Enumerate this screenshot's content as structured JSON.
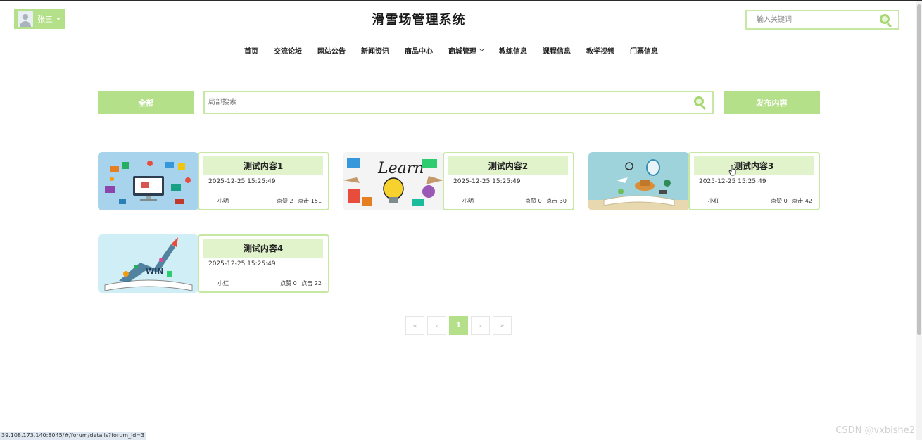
{
  "user": {
    "name": "张三"
  },
  "site": {
    "title": "滑雪场管理系统"
  },
  "top_search": {
    "placeholder": "输入关键词"
  },
  "nav": {
    "items": [
      "首页",
      "交流论坛",
      "网站公告",
      "新闻资讯",
      "商品中心",
      "商城管理",
      "教练信息",
      "课程信息",
      "教学视频",
      "门票信息"
    ]
  },
  "toolbar": {
    "all_label": "全部",
    "local_search_placeholder": "局部搜索",
    "publish_label": "发布内容"
  },
  "posts": [
    {
      "title": "测试内容1",
      "time": "2025-12-25 15:25:49",
      "author": "小明",
      "likes": "点赞 2",
      "clicks": "点击 151",
      "image": "tech-illustration"
    },
    {
      "title": "测试内容2",
      "time": "2025-12-25 15:25:49",
      "author": "小明",
      "likes": "点赞 0",
      "clicks": "点击 30",
      "image": "learn-lightbulb"
    },
    {
      "title": "测试内容3",
      "time": "2025-12-25 15:25:49",
      "author": "小红",
      "likes": "点赞 0",
      "clicks": "点击 42",
      "image": "open-book-travel"
    },
    {
      "title": "测试内容4",
      "time": "2025-12-25 15:25:49",
      "author": "小红",
      "likes": "点赞 0",
      "clicks": "点击 22",
      "image": "book-rocket-win"
    }
  ],
  "pagination": {
    "first": "«",
    "prev": "‹",
    "current": "1",
    "next": "›",
    "last": "»"
  },
  "status_url": "39.108.173.140:8045/#/forum/details?forum_id=3",
  "watermark": "CSDN @vxbishe2",
  "colors": {
    "accent": "#b5e08a",
    "accent_light": "#e0f3cb",
    "border": "#c7e8a3"
  }
}
